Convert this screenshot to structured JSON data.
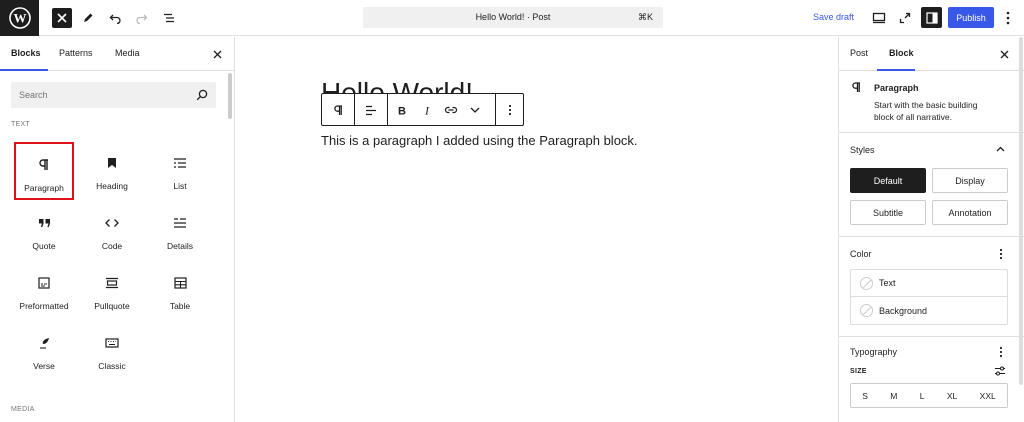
{
  "header": {
    "doc_title": "Hello World! · Post",
    "shortcut": "⌘K",
    "save_draft": "Save draft",
    "publish": "Publish"
  },
  "inserter": {
    "tabs": [
      "Blocks",
      "Patterns",
      "Media"
    ],
    "search_placeholder": "Search",
    "text_section": "TEXT",
    "media_section": "MEDIA",
    "blocks": [
      "Paragraph",
      "Heading",
      "List",
      "Quote",
      "Code",
      "Details",
      "Preformatted",
      "Pullquote",
      "Table",
      "Verse",
      "Classic"
    ]
  },
  "editor": {
    "title": "Hello World!",
    "paragraph": "This is a paragraph I added using the Paragraph block."
  },
  "settings": {
    "tabs": [
      "Post",
      "Block"
    ],
    "block_name": "Paragraph",
    "block_desc_1": "Start with the basic building",
    "block_desc_2": "block of all narrative.",
    "styles_heading": "Styles",
    "styles": [
      "Default",
      "Display",
      "Subtitle",
      "Annotation"
    ],
    "color_heading": "Color",
    "color_items": [
      "Text",
      "Background"
    ],
    "typography_heading": "Typography",
    "size_label": "SIZE",
    "sizes": [
      "S",
      "M",
      "L",
      "XL",
      "XXL"
    ]
  },
  "colors": {
    "accent": "#3858e9",
    "dark": "#1e1e1e",
    "highlight": "#e0101a"
  }
}
